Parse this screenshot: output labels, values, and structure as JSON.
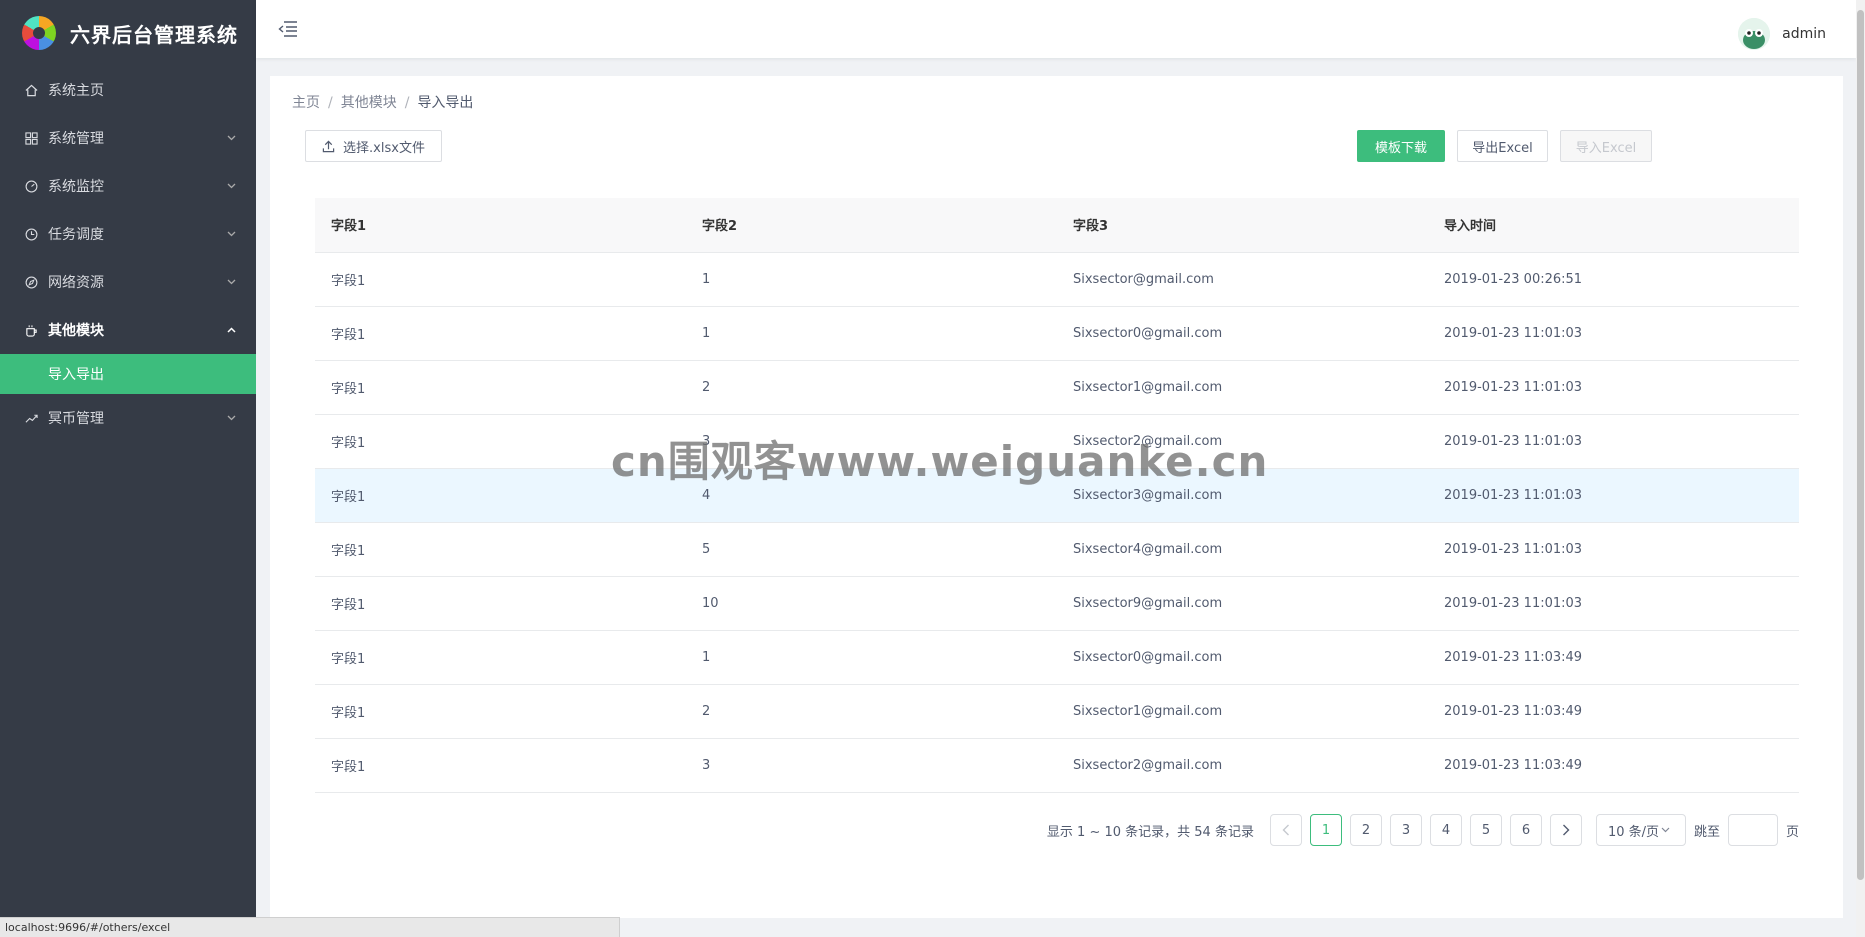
{
  "app": {
    "title": "六界后台管理系统"
  },
  "sidebar": {
    "items": [
      {
        "label": "系统主页",
        "icon": "home-icon",
        "has_children": false
      },
      {
        "label": "系统管理",
        "icon": "grid-icon",
        "has_children": true
      },
      {
        "label": "系统监控",
        "icon": "dashboard-icon",
        "has_children": true
      },
      {
        "label": "任务调度",
        "icon": "clock-icon",
        "has_children": true
      },
      {
        "label": "网络资源",
        "icon": "compass-icon",
        "has_children": true
      },
      {
        "label": "其他模块",
        "icon": "cup-icon",
        "has_children": true,
        "expanded": true
      },
      {
        "label": "冥币管理",
        "icon": "trend-icon",
        "has_children": true
      }
    ],
    "active_submenu": {
      "label": "导入导出"
    }
  },
  "header": {
    "username": "admin"
  },
  "breadcrumb": {
    "home": "主页",
    "parent": "其他模块",
    "current": "导入导出"
  },
  "toolbar": {
    "upload_label": "选择.xlsx文件",
    "template_label": "模板下载",
    "export_label": "导出Excel",
    "import_label": "导入Excel"
  },
  "table": {
    "headers": [
      "字段1",
      "字段2",
      "字段3",
      "导入时间"
    ],
    "rows": [
      [
        "字段1",
        "1",
        "Sixsector@gmail.com",
        "2019-01-23 00:26:51"
      ],
      [
        "字段1",
        "1",
        "Sixsector0@gmail.com",
        "2019-01-23 11:01:03"
      ],
      [
        "字段1",
        "2",
        "Sixsector1@gmail.com",
        "2019-01-23 11:01:03"
      ],
      [
        "字段1",
        "3",
        "Sixsector2@gmail.com",
        "2019-01-23 11:01:03"
      ],
      [
        "字段1",
        "4",
        "Sixsector3@gmail.com",
        "2019-01-23 11:01:03"
      ],
      [
        "字段1",
        "5",
        "Sixsector4@gmail.com",
        "2019-01-23 11:01:03"
      ],
      [
        "字段1",
        "10",
        "Sixsector9@gmail.com",
        "2019-01-23 11:01:03"
      ],
      [
        "字段1",
        "1",
        "Sixsector0@gmail.com",
        "2019-01-23 11:03:49"
      ],
      [
        "字段1",
        "2",
        "Sixsector1@gmail.com",
        "2019-01-23 11:03:49"
      ],
      [
        "字段1",
        "3",
        "Sixsector2@gmail.com",
        "2019-01-23 11:03:49"
      ]
    ],
    "hovered_row_index": 4
  },
  "pagination": {
    "summary": "显示 1 ~ 10 条记录，共 54 条记录",
    "pages": [
      "1",
      "2",
      "3",
      "4",
      "5",
      "6"
    ],
    "current_page": "1",
    "page_size": "10 条/页",
    "jump_label": "跳至",
    "jump_suffix": "页"
  },
  "watermark": "cn围观客www.weiguanke.cn",
  "status_bar": {
    "url": "localhost:9696/#/others/excel"
  },
  "colors": {
    "accent": "#3dbd7d",
    "sidebar_bg": "#353b46",
    "hover_row": "#ebf7ff"
  }
}
